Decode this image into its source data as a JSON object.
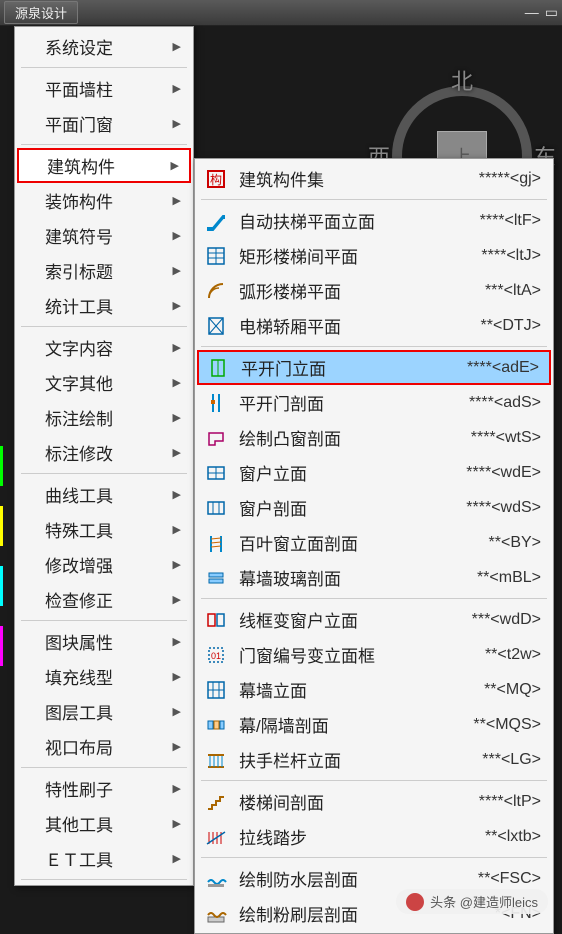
{
  "title": "源泉设计",
  "compass": {
    "north": "北",
    "west": "西",
    "east": "东",
    "top": "上"
  },
  "menu": [
    {
      "label": "系统设定",
      "sep": true
    },
    {
      "label": "平面墙柱"
    },
    {
      "label": "平面门窗",
      "sep": true
    },
    {
      "label": "建筑构件",
      "active": true
    },
    {
      "label": "装饰构件"
    },
    {
      "label": "建筑符号"
    },
    {
      "label": "索引标题"
    },
    {
      "label": "统计工具",
      "sep": true
    },
    {
      "label": "文字内容"
    },
    {
      "label": "文字其他"
    },
    {
      "label": "标注绘制"
    },
    {
      "label": "标注修改",
      "sep": true
    },
    {
      "label": "曲线工具"
    },
    {
      "label": "特殊工具"
    },
    {
      "label": "修改增强"
    },
    {
      "label": "检查修正",
      "sep": true
    },
    {
      "label": "图块属性"
    },
    {
      "label": "填充线型"
    },
    {
      "label": "图层工具"
    },
    {
      "label": "视口布局",
      "sep": true
    },
    {
      "label": "特性刷子"
    },
    {
      "label": "其他工具"
    },
    {
      "label": "ＥＴ工具",
      "sep": true
    }
  ],
  "submenu": [
    {
      "icon": "component-set-icon",
      "label": "建筑构件集",
      "shortcut": "*****<gj>",
      "sep": true
    },
    {
      "icon": "escalator-icon",
      "label": "自动扶梯平面立面",
      "shortcut": "****<ltF>"
    },
    {
      "icon": "rect-stair-icon",
      "label": "矩形楼梯间平面",
      "shortcut": "****<ltJ>"
    },
    {
      "icon": "arc-stair-icon",
      "label": "弧形楼梯平面",
      "shortcut": "***<ltA>"
    },
    {
      "icon": "elevator-icon",
      "label": "电梯轿厢平面",
      "shortcut": "**<DTJ>",
      "sep": true
    },
    {
      "icon": "door-elev-icon",
      "label": "平开门立面",
      "shortcut": "****<adE>",
      "highlight": true
    },
    {
      "icon": "door-section-icon",
      "label": "平开门剖面",
      "shortcut": "****<adS>"
    },
    {
      "icon": "bay-window-icon",
      "label": "绘制凸窗剖面",
      "shortcut": "****<wtS>"
    },
    {
      "icon": "window-elev-icon",
      "label": "窗户立面",
      "shortcut": "****<wdE>"
    },
    {
      "icon": "window-section-icon",
      "label": "窗户剖面",
      "shortcut": "****<wdS>"
    },
    {
      "icon": "louver-icon",
      "label": "百叶窗立面剖面",
      "shortcut": "**<BY>"
    },
    {
      "icon": "curtain-glass-icon",
      "label": "幕墙玻璃剖面",
      "shortcut": "**<mBL>",
      "sep": true
    },
    {
      "icon": "wireframe-window-icon",
      "label": "线框变窗户立面",
      "shortcut": "***<wdD>"
    },
    {
      "icon": "door-window-frame-icon",
      "label": "门窗编号变立面框",
      "shortcut": "**<t2w>"
    },
    {
      "icon": "curtain-wall-icon",
      "label": "幕墙立面",
      "shortcut": "**<MQ>"
    },
    {
      "icon": "curtain-partition-icon",
      "label": "幕/隔墙剖面",
      "shortcut": "**<MQS>"
    },
    {
      "icon": "handrail-icon",
      "label": "扶手栏杆立面",
      "shortcut": "***<LG>",
      "sep": true
    },
    {
      "icon": "stair-section-icon",
      "label": "楼梯间剖面",
      "shortcut": "****<ltP>"
    },
    {
      "icon": "steps-icon",
      "label": "拉线踏步",
      "shortcut": "**<lxtb>",
      "sep": true
    },
    {
      "icon": "waterproof-icon",
      "label": "绘制防水层剖面",
      "shortcut": "**<FSC>"
    },
    {
      "icon": "plaster-icon",
      "label": "绘制粉刷层剖面",
      "shortcut": "*<FN>"
    }
  ],
  "watermark": "头条 @建造师leics"
}
